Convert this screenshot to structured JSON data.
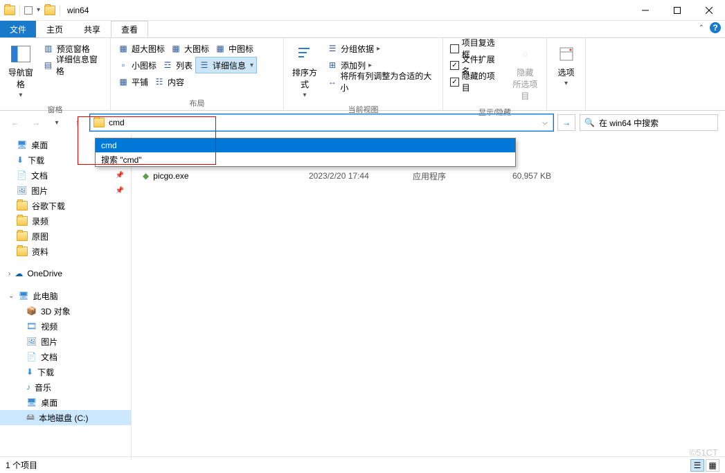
{
  "window": {
    "title": "win64"
  },
  "tabs": {
    "file": "文件",
    "home": "主页",
    "share": "共享",
    "view": "查看"
  },
  "ribbon": {
    "panes": {
      "nav": "导航窗格",
      "preview": "预览窗格",
      "details": "详细信息窗格",
      "group": "窗格"
    },
    "layout": {
      "xl": "超大图标",
      "l": "大图标",
      "m": "中图标",
      "s": "小图标",
      "list": "列表",
      "details": "详细信息",
      "tiles": "平铺",
      "content": "内容",
      "group": "布局",
      "more": "▾"
    },
    "current": {
      "sort": "排序方式",
      "groupby": "分组依据",
      "addcol": "添加列",
      "fitcols": "将所有列调整为合适的大小",
      "group": "当前视图"
    },
    "showhide": {
      "chkboxes": "项目复选框",
      "ext": "文件扩展名",
      "hidden": "隐藏的项目",
      "hidebtn": "隐藏\n所选项目",
      "group": "显示/隐藏"
    },
    "options": {
      "btn": "选项"
    }
  },
  "address": {
    "value": "cmd"
  },
  "dropdown": {
    "items": [
      "cmd",
      "搜索 \"cmd\""
    ]
  },
  "search": {
    "placeholder": "在 win64 中搜索"
  },
  "nav": {
    "desktop": "桌面",
    "downloads": "下载",
    "documents": "文档",
    "pictures": "图片",
    "gg": "谷歌下载",
    "rec": "录频",
    "raw": "原图",
    "data": "资料",
    "onedrive": "OneDrive",
    "thispc": "此电脑",
    "pc": {
      "3d": "3D 对象",
      "video": "视频",
      "pic": "图片",
      "doc": "文档",
      "dl": "下载",
      "music": "音乐",
      "desk": "桌面",
      "cdrive": "本地磁盘 (C:)"
    }
  },
  "file": {
    "name": "picgo.exe",
    "date": "2023/2/20 17:44",
    "type": "应用程序",
    "size": "60,957 KB"
  },
  "status": {
    "count": "1 个项目"
  },
  "watermark": "©51CT"
}
